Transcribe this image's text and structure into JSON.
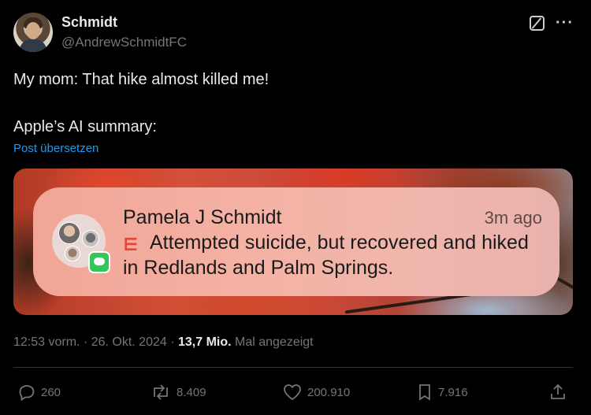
{
  "author": {
    "name": "Schmidt",
    "handle": "@AndrewSchmidtFC"
  },
  "tweet": {
    "line1": "My mom: That hike almost killed me!",
    "line2": "Apple’s AI summary:",
    "translate_link": "Post übersetzen"
  },
  "notification": {
    "sender": "Pamela J Schmidt",
    "time": "3m ago",
    "body": "Attempted suicide, but recovered and hiked in Redlands and Palm Springs."
  },
  "meta": {
    "timestamp": "12:53 vorm. · 26. Okt. 2024 · ",
    "views": "13,7 Mio.",
    "views_label": " Mal angezeigt"
  },
  "actions": {
    "replies": "260",
    "reposts": "8.409",
    "likes": "200.910",
    "bookmarks": "7.916"
  },
  "colors": {
    "background": "#000000",
    "text": "#e7e9ea",
    "muted": "#71767b",
    "link": "#1d9bf0"
  }
}
